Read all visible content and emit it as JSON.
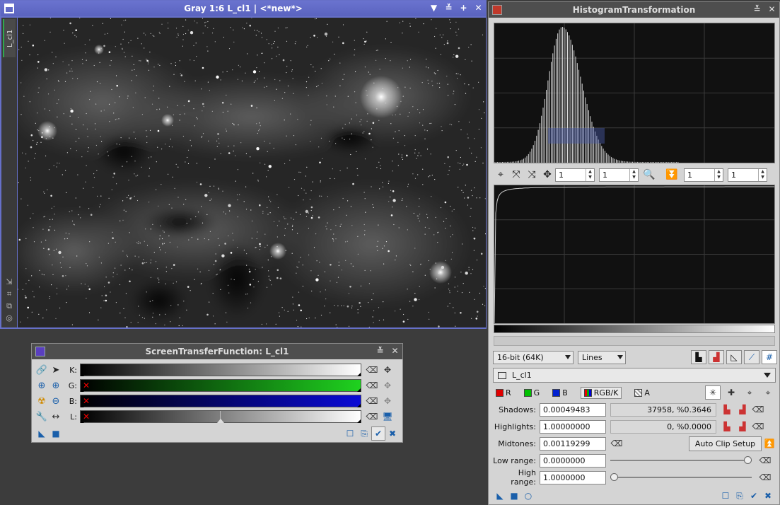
{
  "image_window": {
    "title": "Gray 1:6 L_cl1 | <*new*>",
    "side_tab": "L_cl1",
    "buttons": [
      "▼",
      "≚",
      "+",
      "✕"
    ]
  },
  "stf": {
    "title": "ScreenTransferFunction: L_cl1",
    "channels": [
      {
        "label": "K:",
        "color": "#ffffff",
        "disabled": false
      },
      {
        "label": "G:",
        "color": "#1fd21f",
        "disabled": true
      },
      {
        "label": "B:",
        "color": "#0a0ad6",
        "disabled": true
      },
      {
        "label": "L:",
        "color": "#ffffff",
        "disabled": true
      }
    ]
  },
  "histogram": {
    "title": "HistogramTransformation",
    "zoom": {
      "h1": "1",
      "v1": "1",
      "h2": "1",
      "v2": "1"
    },
    "bit_depth": "16-bit (64K)",
    "graph_style": "Lines",
    "target_image": "L_cl1",
    "channels": {
      "r": "R",
      "g": "G",
      "b": "B",
      "rgbk": "RGB/K",
      "a": "A"
    },
    "shadows": {
      "label": "Shadows:",
      "value": "0.00049483",
      "clip": "37958, %0.3646"
    },
    "highlights": {
      "label": "Highlights:",
      "value": "1.00000000",
      "clip": "0, %0.0000"
    },
    "midtones": {
      "label": "Midtones:",
      "value": "0.00119299"
    },
    "auto_clip_label": "Auto Clip Setup",
    "low_range": {
      "label": "Low range:",
      "value": "0.0000000",
      "slider": 1.0
    },
    "high_range": {
      "label": "High range:",
      "value": "1.0000000",
      "slider": 0.0
    },
    "colors": {
      "r": "#e00000",
      "g": "#00c000",
      "b": "#0020d0"
    }
  }
}
